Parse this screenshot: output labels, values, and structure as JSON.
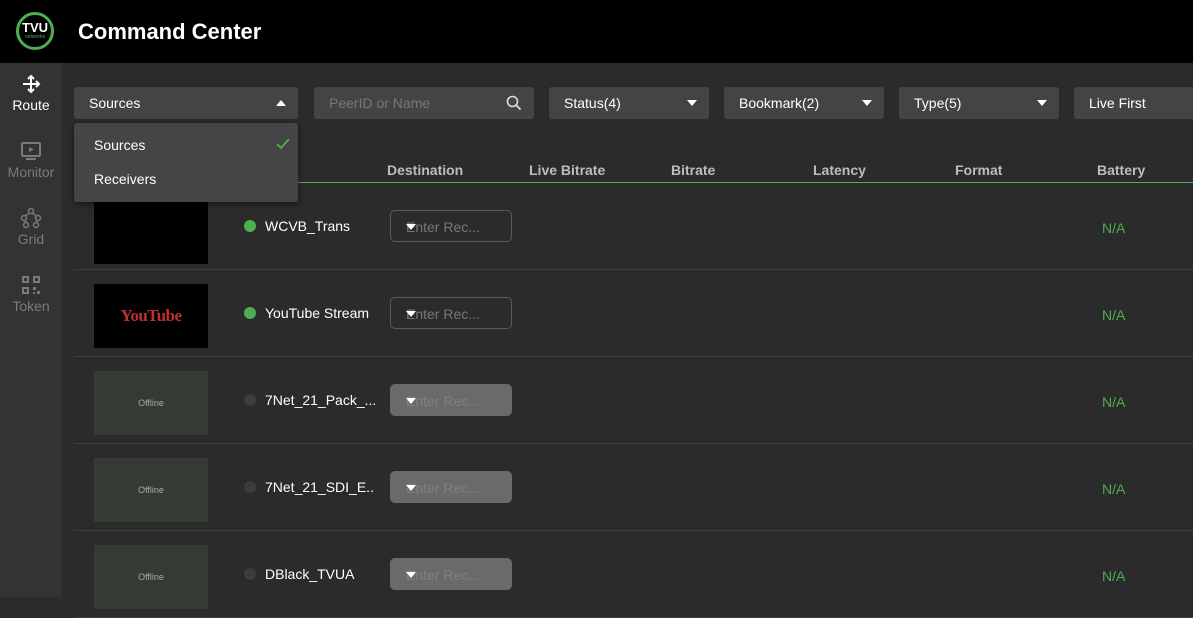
{
  "app": {
    "logo_text": "TVU",
    "logo_sub": "networks",
    "title": "Command Center"
  },
  "sidebar": {
    "items": [
      {
        "label": "Route",
        "icon": "route-icon",
        "active": true
      },
      {
        "label": "Monitor",
        "icon": "monitor-icon",
        "active": false
      },
      {
        "label": "Grid",
        "icon": "grid-icon",
        "active": false
      },
      {
        "label": "Token",
        "icon": "qr-token-icon",
        "active": false
      }
    ]
  },
  "filters": {
    "source_type": "Sources",
    "search_placeholder": "PeerID or Name",
    "status": "Status(4)",
    "bookmark": "Bookmark(2)",
    "type": "Type(5)",
    "sort": "Live First"
  },
  "dropdown": {
    "options": [
      {
        "label": "Sources",
        "selected": true
      },
      {
        "label": "Receivers",
        "selected": false
      }
    ]
  },
  "table": {
    "columns": [
      "Destination",
      "Live Bitrate",
      "Bitrate",
      "Latency",
      "Format",
      "Battery"
    ],
    "rows": [
      {
        "thumb": "",
        "status": "online",
        "name": "WCVB_Trans",
        "dest_placeholder": "Enter Rec...",
        "battery": "N/A"
      },
      {
        "thumb": "YouTube",
        "status": "online",
        "name": "YouTube Stream",
        "dest_placeholder": "Enter Rec...",
        "battery": "N/A"
      },
      {
        "thumb": "Offline",
        "status": "offline",
        "name": "7Net_21_Pack_...",
        "dest_placeholder": "Enter Rec...",
        "battery": "N/A"
      },
      {
        "thumb": "Offline",
        "status": "offline",
        "name": "7Net_21_SDI_E...",
        "dest_placeholder": "Enter Rec...",
        "battery": "N/A"
      },
      {
        "thumb": "Offline",
        "status": "offline",
        "name": "DBlack_TVUA",
        "dest_placeholder": "Enter Rec...",
        "battery": "N/A"
      }
    ]
  },
  "colors": {
    "accent": "#4caf50",
    "offline_dot": "#3c3c3c",
    "header_bg": "#000000"
  }
}
